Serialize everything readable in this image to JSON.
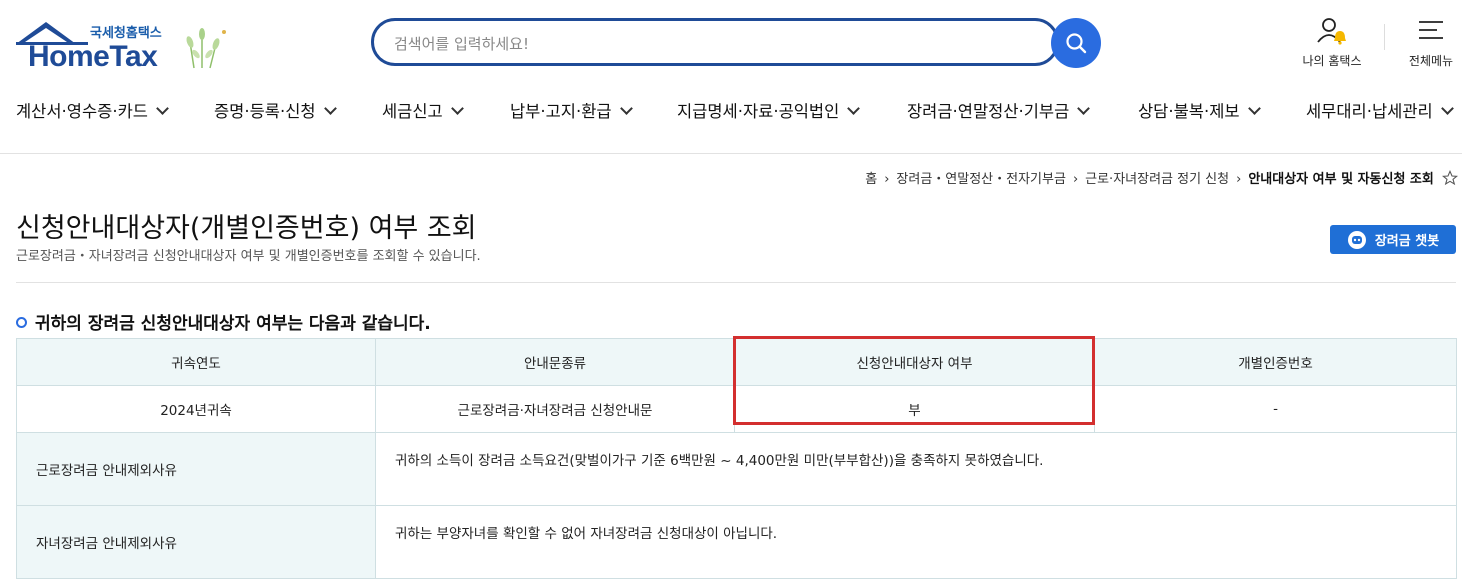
{
  "header": {
    "logo_small": "국세청홈택스",
    "logo_main": "HomeTax",
    "search_placeholder": "검색어를 입력하세요!",
    "my_hometax": "나의 홈택스",
    "all_menu": "전체메뉴"
  },
  "nav": [
    {
      "label": "계산서·영수증·카드"
    },
    {
      "label": "증명·등록·신청"
    },
    {
      "label": "세금신고"
    },
    {
      "label": "납부·고지·환급"
    },
    {
      "label": "지급명세·자료·공익법인"
    },
    {
      "label": "장려금·연말정산·기부금"
    },
    {
      "label": "상담·불복·제보"
    },
    {
      "label": "세무대리·납세관리"
    }
  ],
  "breadcrumb": [
    "홈",
    "장려금・연말정산・전자기부금",
    "근로·자녀장려금 정기 신청",
    "안내대상자 여부 및 자동신청 조회"
  ],
  "page": {
    "title": "신청안내대상자(개별인증번호) 여부 조회",
    "description": "근로장려금・자녀장려금 신청안내대상자 여부 및 개별인증번호를 조회할 수 있습니다.",
    "chatbot_label": "장려금 챗봇"
  },
  "section_title": "귀하의 장려금 신청안내대상자 여부는 다음과 같습니다.",
  "table": {
    "headers": [
      "귀속연도",
      "안내문종류",
      "신청안내대상자 여부",
      "개별인증번호"
    ],
    "row": [
      "2024년귀속",
      "근로장려금·자녀장려금 신청안내문",
      "부",
      "-"
    ],
    "reasons": [
      {
        "label": "근로장려금 안내제외사유",
        "text": "귀하의 소득이 장려금 소득요건(맞벌이가구 기준 6백만원 ~ 4,400만원 미만(부부합산))을 충족하지 못하였습니다."
      },
      {
        "label": "자녀장려금 안내제외사유",
        "text": "귀하는 부양자녀를 확인할 수 없어 자녀장려금 신청대상이 아닙니다."
      }
    ]
  },
  "colors": {
    "brand_blue": "#1f4b97",
    "search_button": "#2a6ce0",
    "table_header_bg": "#eef7f8",
    "highlight_red": "#d32f2f"
  }
}
